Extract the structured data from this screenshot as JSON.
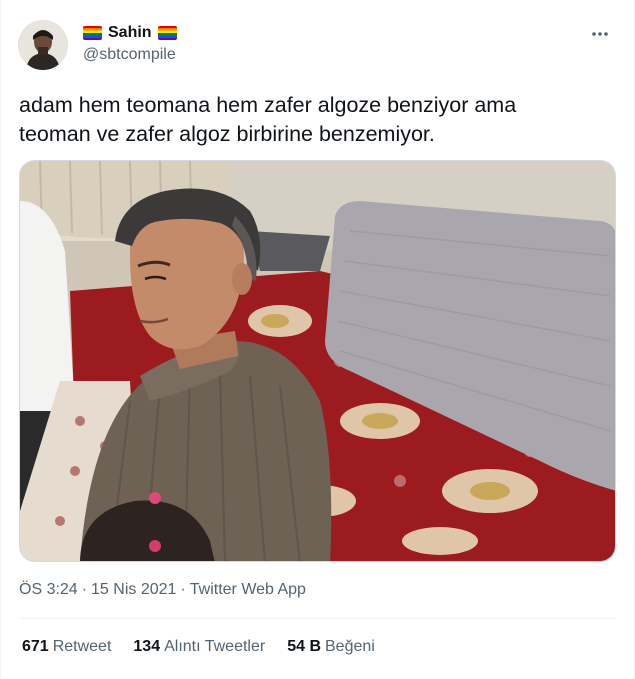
{
  "user": {
    "display_name": "Sahin",
    "handle": "@sbtcompile",
    "avatar_icon": "user-avatar",
    "flag_icon": "rainbow-flag-icon"
  },
  "menu": {
    "icon": "more-horizontal-icon"
  },
  "tweet": {
    "text_line1": "adam hem teomana hem zafer algoze benziyor ama",
    "text_line2": "teoman ve zafer algoz birbirine benzemiyor."
  },
  "meta": {
    "time": "ÖS 3:24",
    "sep1": "·",
    "date": "15 Nis 2021",
    "sep2": "·",
    "source": "Twitter Web App"
  },
  "stats": [
    {
      "count": "671",
      "label": "Retweet"
    },
    {
      "count": "134",
      "label": "Alıntı Tweetler"
    },
    {
      "count": "54 B",
      "label": "Beğeni"
    }
  ],
  "colors": {
    "text_primary": "#0f1419",
    "text_secondary": "#536471",
    "border": "#eff3f4"
  }
}
